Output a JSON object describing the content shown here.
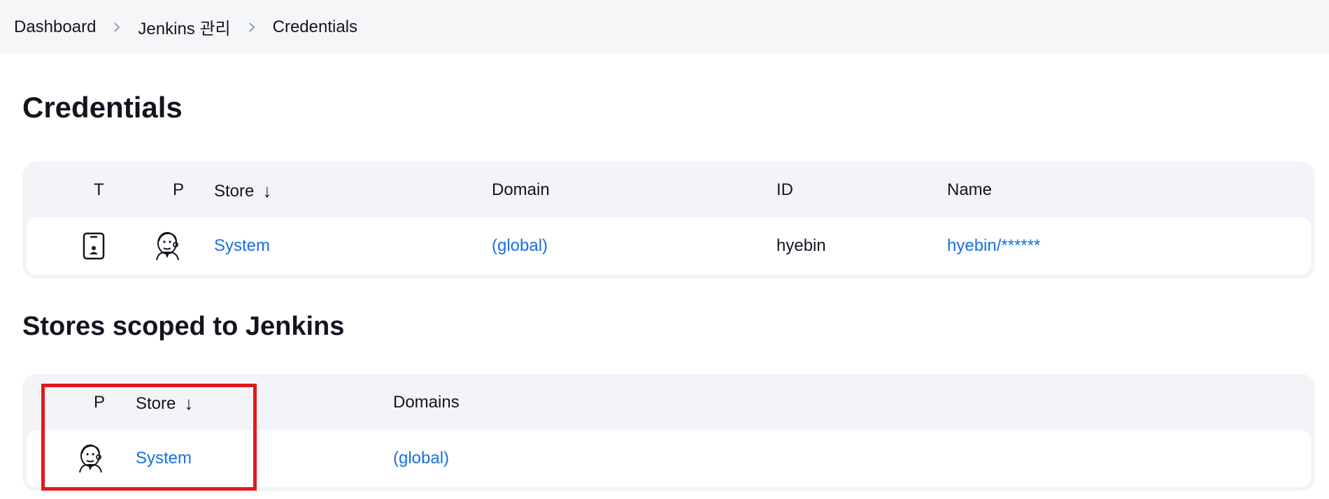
{
  "breadcrumb": {
    "items": [
      "Dashboard",
      "Jenkins 관리",
      "Credentials"
    ]
  },
  "page_title": "Credentials",
  "credentials_table": {
    "headers": {
      "type": "T",
      "provider": "P",
      "store": "Store",
      "domain": "Domain",
      "id": "ID",
      "name": "Name",
      "sort_arrow": "↓"
    },
    "rows": [
      {
        "type_icon": "mobile-device-icon",
        "provider_icon": "jenkins-butler-icon",
        "store": "System",
        "domain": "(global)",
        "id": "hyebin",
        "name": "hyebin/******"
      }
    ]
  },
  "section_title": "Stores scoped to Jenkins",
  "stores_table": {
    "headers": {
      "provider": "P",
      "store": "Store",
      "domains": "Domains",
      "sort_arrow": "↓"
    },
    "rows": [
      {
        "provider_icon": "jenkins-butler-icon",
        "store": "System",
        "domains": "(global)"
      }
    ]
  },
  "colors": {
    "link": "#1a6fe0",
    "highlight": "#e0191d",
    "table_bg": "#f2f4f7"
  }
}
